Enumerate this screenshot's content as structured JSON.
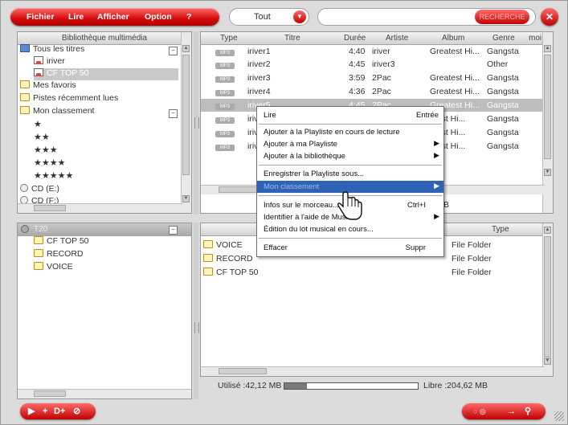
{
  "menu": {
    "fichier": "Fichier",
    "lire": "Lire",
    "afficher": "Afficher",
    "option": "Option",
    "help": "?"
  },
  "filter": {
    "selected": "Tout"
  },
  "search": {
    "button": "RECHERCHE"
  },
  "library": {
    "header": "Bibliothèque multimédia",
    "items": [
      "Tous les titres",
      "iriver",
      "CF TOP 50",
      "Mes favoris",
      "Pistes récemment lues",
      "Mon classement",
      "★",
      "★★",
      "★★★",
      "★★★★",
      "★★★★★",
      "CD (E:)",
      "CD (F:)"
    ]
  },
  "tracks": {
    "columns": [
      "Type",
      "Titre",
      "Durée",
      "Artiste",
      "Album",
      "Genre",
      "moi"
    ],
    "type_tag": "MP3",
    "rows": [
      {
        "title": "iriver1",
        "duration": "4:40",
        "artist": "iriver",
        "album": "Greatest Hi...",
        "genre": "Gangsta"
      },
      {
        "title": "iriver2",
        "duration": "4:45",
        "artist": "iriver3",
        "album": "",
        "genre": "Other"
      },
      {
        "title": "iriver3",
        "duration": "3:59",
        "artist": "2Pac",
        "album": "Greatest Hi...",
        "genre": "Gangsta"
      },
      {
        "title": "iriver4",
        "duration": "4:36",
        "artist": "2Pac",
        "album": "Greatest Hi...",
        "genre": "Gangsta"
      },
      {
        "title": "iriver5",
        "duration": "4:45",
        "artist": "2Pac",
        "album": "Greatest Hi...",
        "genre": "Gangsta"
      },
      {
        "title": "iriver6",
        "duration": "",
        "artist": "",
        "album": "atest Hi...",
        "genre": "Gangsta"
      },
      {
        "title": "iriver7",
        "duration": "",
        "artist": "",
        "album": "atest Hi...",
        "genre": "Gangsta"
      },
      {
        "title": "iriver8",
        "duration": "",
        "artist": "",
        "album": "atest Hi...",
        "genre": "Gangsta"
      }
    ],
    "count_fragment": "B"
  },
  "device": {
    "header": "T20",
    "items": [
      "CF TOP 50",
      "RECORD",
      "VOICE"
    ]
  },
  "files": {
    "type_header": "Type",
    "rows": [
      {
        "name": "VOICE",
        "type": "File Folder"
      },
      {
        "name": "RECORD",
        "type": "File Folder"
      },
      {
        "name": "CF TOP 50",
        "type": "File Folder"
      }
    ]
  },
  "status": {
    "used": "Utilisé :42,12 MB",
    "free": "Libre :204,62 MB",
    "used_fraction": 0.17
  },
  "context_menu": {
    "items": [
      {
        "label": "Lire",
        "shortcut": "Entrée"
      },
      {
        "label": "Ajouter à la Playliste en cours de lecture"
      },
      {
        "label": "Ajouter à ma Playliste"
      },
      {
        "label": "Ajouter à la bibliothèque"
      },
      {
        "label": "Enregistrer la Playliste sous..."
      },
      {
        "label": "Mon classement"
      },
      {
        "label": "Infos sur le morceau...",
        "shortcut": "Ctrl+I"
      },
      {
        "label": "Identifier à l'aide de MusicID"
      },
      {
        "label": "Édition du lot musical en cours..."
      },
      {
        "label": "Effacer",
        "shortcut": "Suppr"
      }
    ]
  }
}
